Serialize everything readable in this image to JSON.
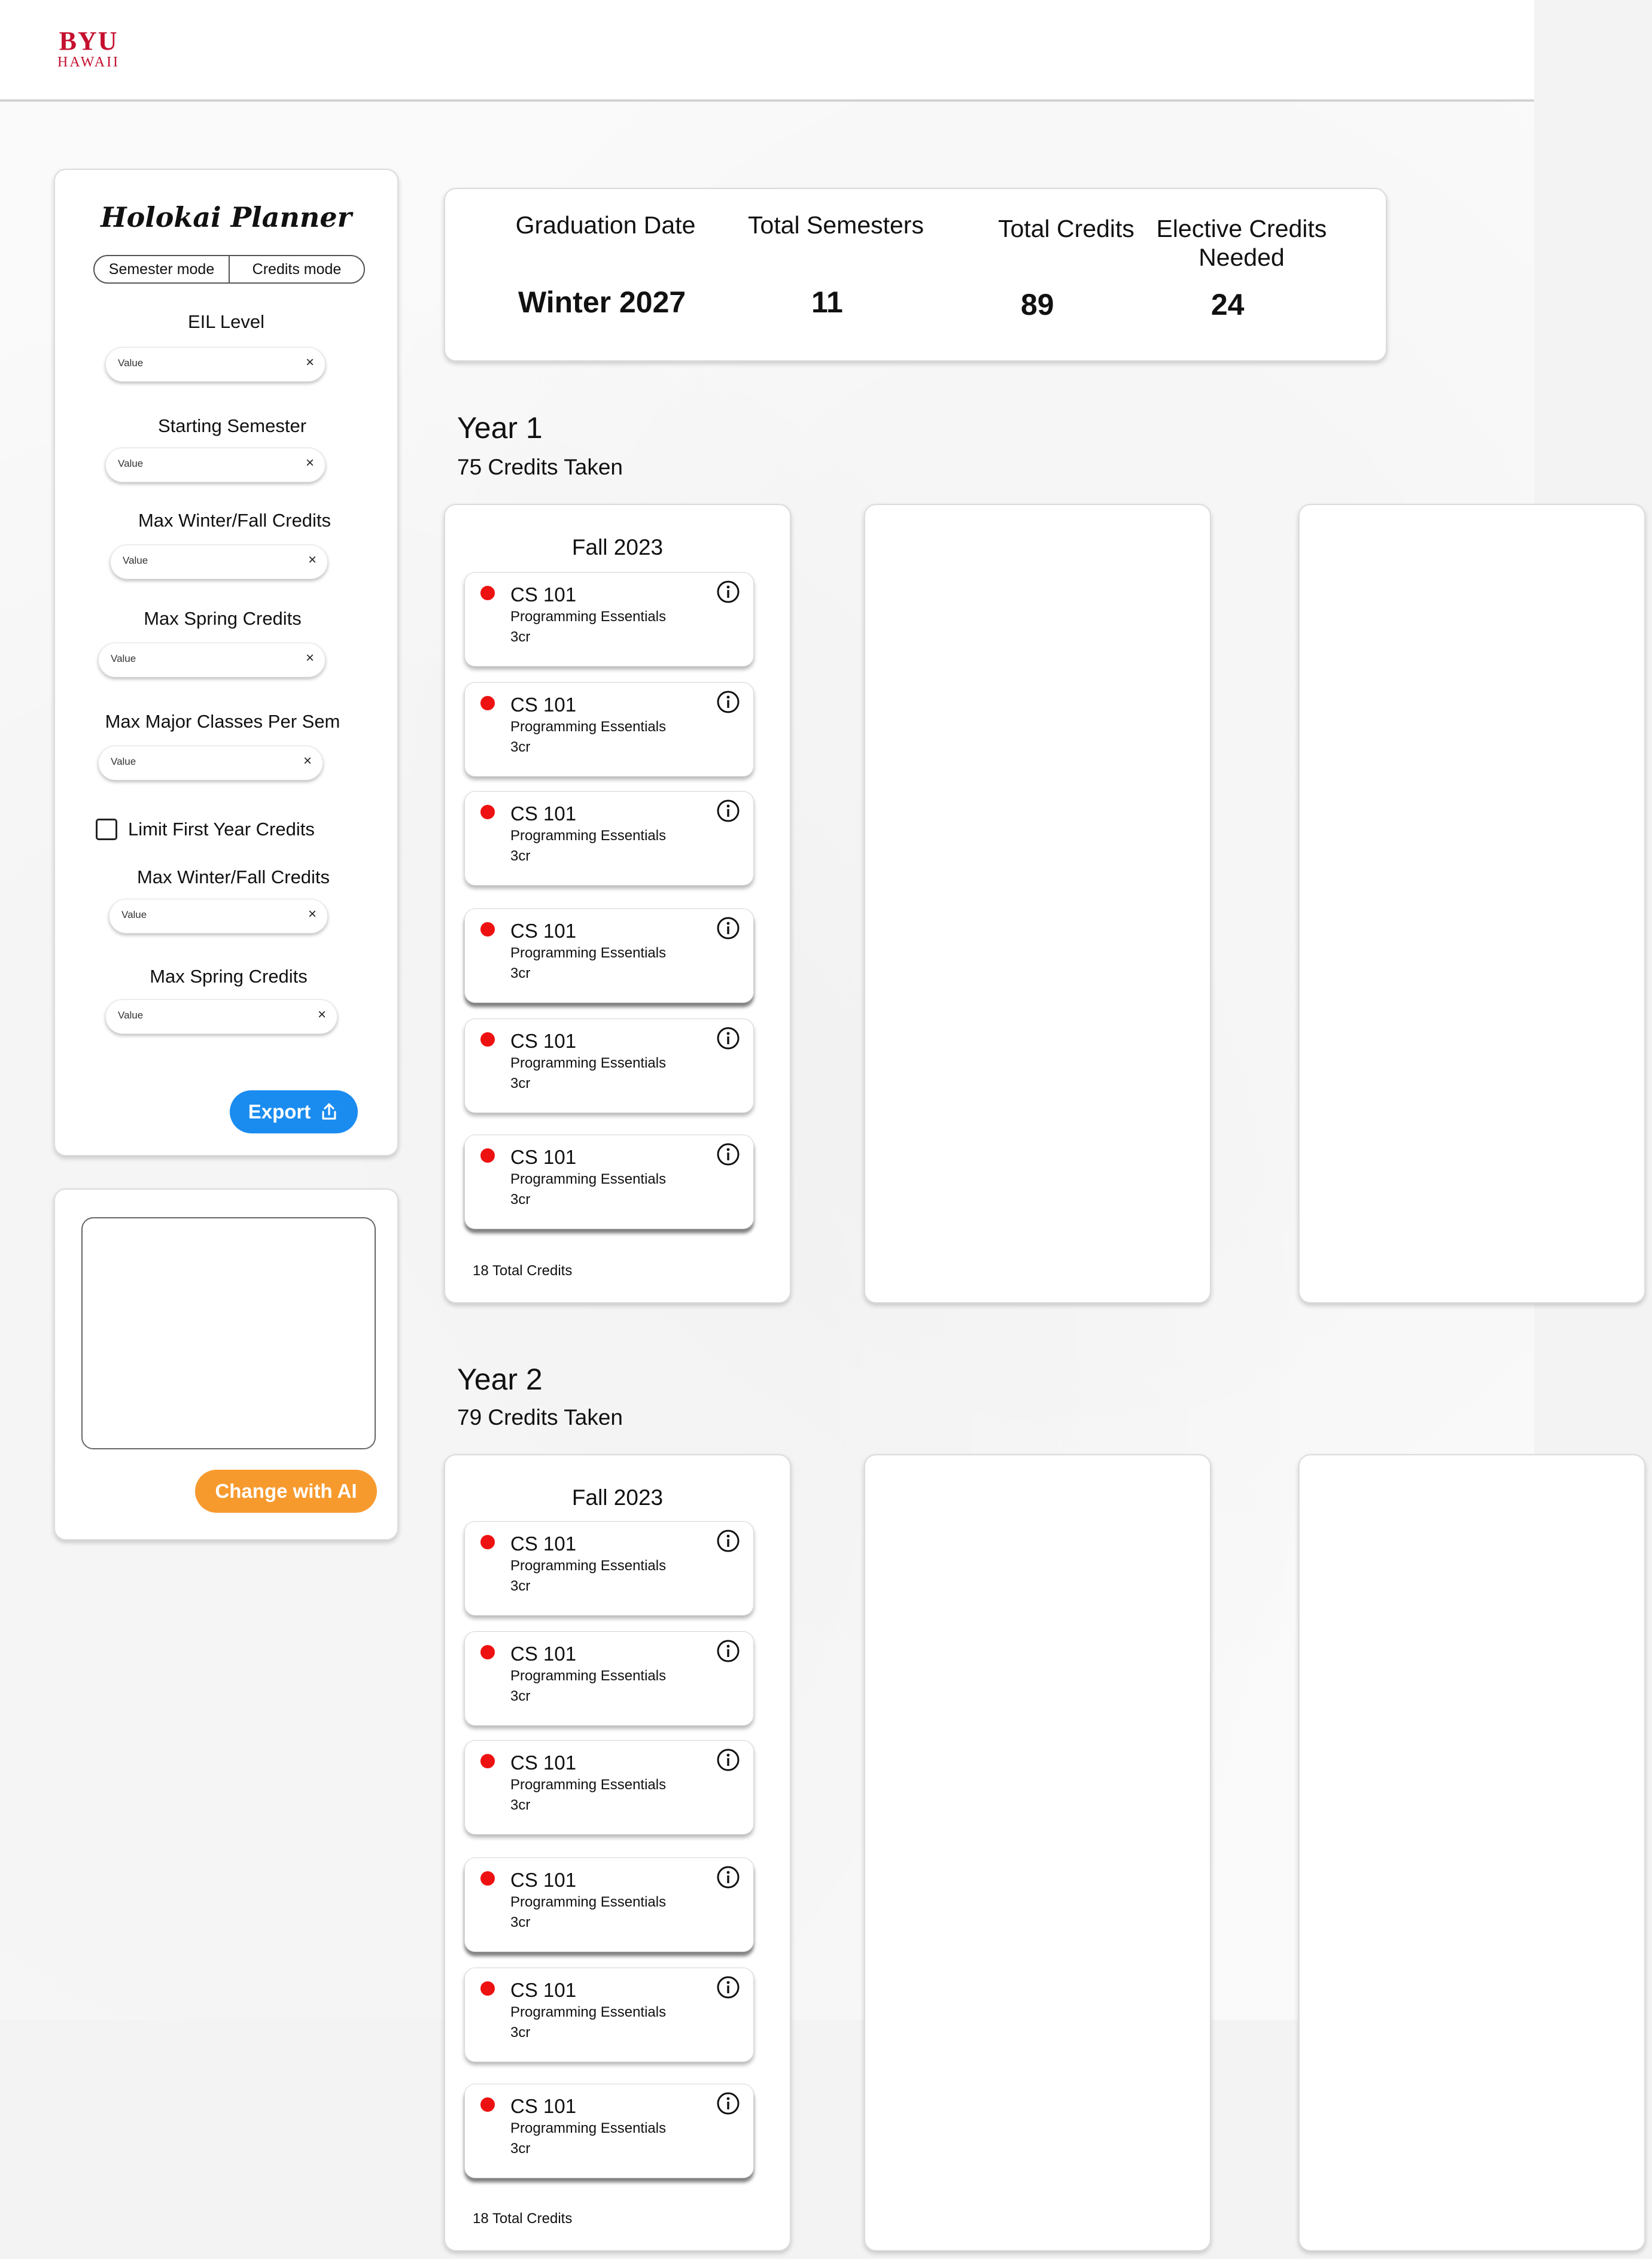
{
  "brand": {
    "logo_line1": "BYU",
    "logo_line2": "HAWAII"
  },
  "sidebar": {
    "title": "Holokai Planner",
    "modes": [
      "Semester mode",
      "Credits mode"
    ],
    "fields": [
      {
        "label": "EIL Level",
        "value": "Value"
      },
      {
        "label": "Starting Semester",
        "value": "Value"
      },
      {
        "label": "Max Winter/Fall Credits",
        "value": "Value"
      },
      {
        "label": "Max Spring Credits",
        "value": "Value"
      },
      {
        "label": "Max Major Classes Per Sem",
        "value": "Value"
      },
      {
        "label": "Max Winter/Fall Credits",
        "value": "Value"
      },
      {
        "label": "Max Spring Credits",
        "value": "Value"
      }
    ],
    "limit_first_year_label": "Limit First Year Credits",
    "limit_first_year_checked": false,
    "export_label": "Export"
  },
  "ai": {
    "prompt_value": "",
    "button_label": "Change with AI"
  },
  "stats": [
    {
      "label": "Graduation Date",
      "value": "Winter 2027"
    },
    {
      "label": "Total Semesters",
      "value": "11"
    },
    {
      "label": "Total Credits",
      "value": "89"
    },
    {
      "label": "Elective Credits Needed",
      "value": "24"
    }
  ],
  "years": [
    {
      "title": "Year 1",
      "subtitle": "75 Credits Taken",
      "semesters": [
        {
          "title": "Fall 2023",
          "total": "18 Total Credits",
          "courses": [
            {
              "code": "CS 101",
              "name": "Programming Essentials",
              "credits": "3cr"
            },
            {
              "code": "CS 101",
              "name": "Programming Essentials",
              "credits": "3cr"
            },
            {
              "code": "CS 101",
              "name": "Programming Essentials",
              "credits": "3cr"
            },
            {
              "code": "CS 101",
              "name": "Programming Essentials",
              "credits": "3cr"
            },
            {
              "code": "CS 101",
              "name": "Programming Essentials",
              "credits": "3cr"
            },
            {
              "code": "CS 101",
              "name": "Programming Essentials",
              "credits": "3cr"
            }
          ]
        }
      ]
    },
    {
      "title": "Year 2",
      "subtitle": "79 Credits Taken",
      "semesters": [
        {
          "title": "Fall 2023",
          "total": "18 Total Credits",
          "courses": [
            {
              "code": "CS 101",
              "name": "Programming Essentials",
              "credits": "3cr"
            },
            {
              "code": "CS 101",
              "name": "Programming Essentials",
              "credits": "3cr"
            },
            {
              "code": "CS 101",
              "name": "Programming Essentials",
              "credits": "3cr"
            },
            {
              "code": "CS 101",
              "name": "Programming Essentials",
              "credits": "3cr"
            },
            {
              "code": "CS 101",
              "name": "Programming Essentials",
              "credits": "3cr"
            },
            {
              "code": "CS 101",
              "name": "Programming Essentials",
              "credits": "3cr"
            }
          ]
        }
      ]
    }
  ],
  "colors": {
    "brand_red": "#c5102e",
    "export_blue": "#1a8cf0",
    "ai_orange": "#f79a2e",
    "course_dot_red": "#ee1111"
  }
}
